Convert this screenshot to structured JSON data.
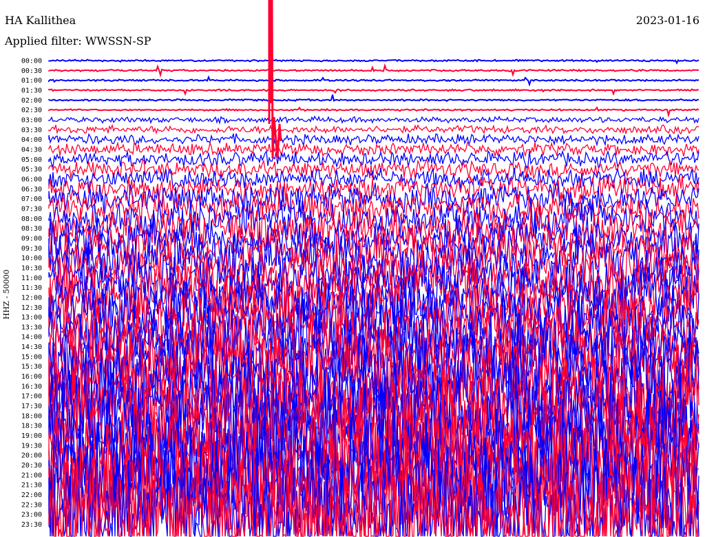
{
  "header": {
    "station": "HA Kallithea",
    "filter": "Applied filter: WWSSN-SP",
    "date": "2023-01-16"
  },
  "chart_data": {
    "type": "line",
    "title": "",
    "ylabel": "HHZ - 50000",
    "rows": [
      "00:00",
      "00:30",
      "01:00",
      "01:30",
      "02:00",
      "02:30",
      "03:00",
      "03:30",
      "04:00",
      "04:30",
      "05:00",
      "05:30",
      "06:00",
      "06:30",
      "07:00",
      "07:30",
      "08:00",
      "08:30",
      "09:00",
      "09:30",
      "10:00",
      "10:30",
      "11:00",
      "11:30",
      "12:00",
      "12:30",
      "13:00",
      "13:30",
      "14:00",
      "14:30",
      "15:00",
      "15:30",
      "16:00",
      "16:30",
      "17:00",
      "17:30",
      "18:00",
      "18:30",
      "19:00",
      "19:30",
      "20:00",
      "20:30",
      "21:00",
      "21:30",
      "22:00",
      "22:30",
      "23:00",
      "23:30"
    ],
    "series_colors": [
      "#0000ff",
      "#ff0033"
    ]
  }
}
